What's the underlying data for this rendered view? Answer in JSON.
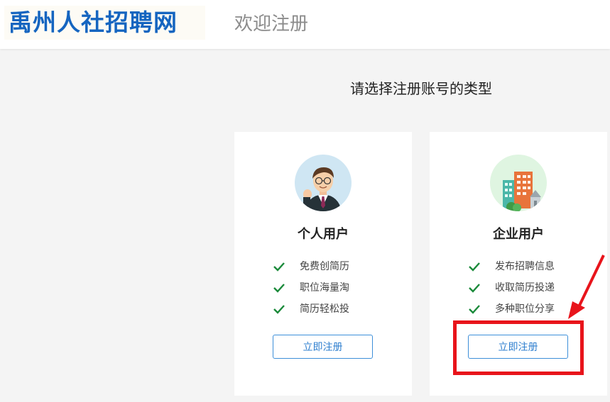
{
  "header": {
    "logo_text": "禹州人社招聘网",
    "welcome": "欢迎注册"
  },
  "main": {
    "prompt": "请选择注册账号的类型",
    "cards": [
      {
        "title": "个人用户",
        "icon": "person-avatar-icon",
        "features": [
          "免费创简历",
          "职位海量淘",
          "简历轻松投"
        ],
        "button_label": "立即注册"
      },
      {
        "title": "企业用户",
        "icon": "building-icon",
        "features": [
          "发布招聘信息",
          "收取简历投递",
          "多种职位分享"
        ],
        "button_label": "立即注册"
      }
    ]
  },
  "colors": {
    "brand": "#1565c0",
    "check": "#1a8a3a",
    "button": "#2f7fcf",
    "annotation": "#e8141b"
  }
}
